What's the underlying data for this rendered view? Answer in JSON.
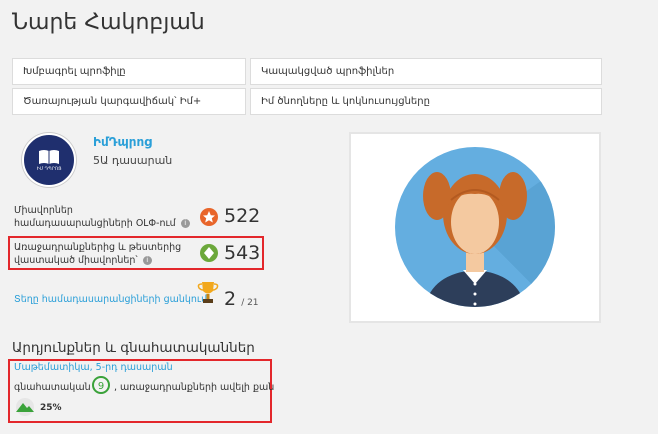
{
  "profile": {
    "name": "Նարե Հակոբյան"
  },
  "nav": {
    "edit_profile": "Խմբագրել պրոֆիլը",
    "linked_profiles": "Կապակցված պրոֆիլներ",
    "service_settings": "Ծառայության կարգավիճակ՝ Իմ+",
    "parents_teachers": "Իմ ծնողները և կոկնուսույցները"
  },
  "school": {
    "name": "ԻմԴպրոց",
    "grade": "5Ա դասարան",
    "logo_text": "ԻՄ ԴՊՐՈՑ"
  },
  "stats": {
    "olympiad_points_label": "Միավորներ համադասարանցիների ՕԼՓ-ում",
    "olympiad_points_value": "522",
    "tasks_points_label_line1": "Առաջադրանքներից և թեստերից",
    "tasks_points_label_line2": "վաստակած միավորներ՝",
    "tasks_points_value": "543",
    "classmates_link": "Տեղը համադասարանցիների ցանկում",
    "rank_value": "2",
    "rank_total": "/ 21",
    "info_glyph": "i"
  },
  "achievements": {
    "section_title": "Արդյունքներ և գնահատականներ",
    "subject_link": "Մաթեմատիկա, 5-րդ դասարան",
    "grade_label": "գնահատական",
    "grade_value": "9",
    "grade_suffix": ", առաջադրանքների ավելի քան",
    "progress_label": "25%",
    "progress_fraction": 0.25
  },
  "colors": {
    "accent": "#2a9fd8",
    "highlight": "#e3272b",
    "medal_orange": "#e8652a",
    "medal_green": "#6ca83b",
    "grade_green": "#3aa23a",
    "avatar_bg": "#64aee0"
  }
}
